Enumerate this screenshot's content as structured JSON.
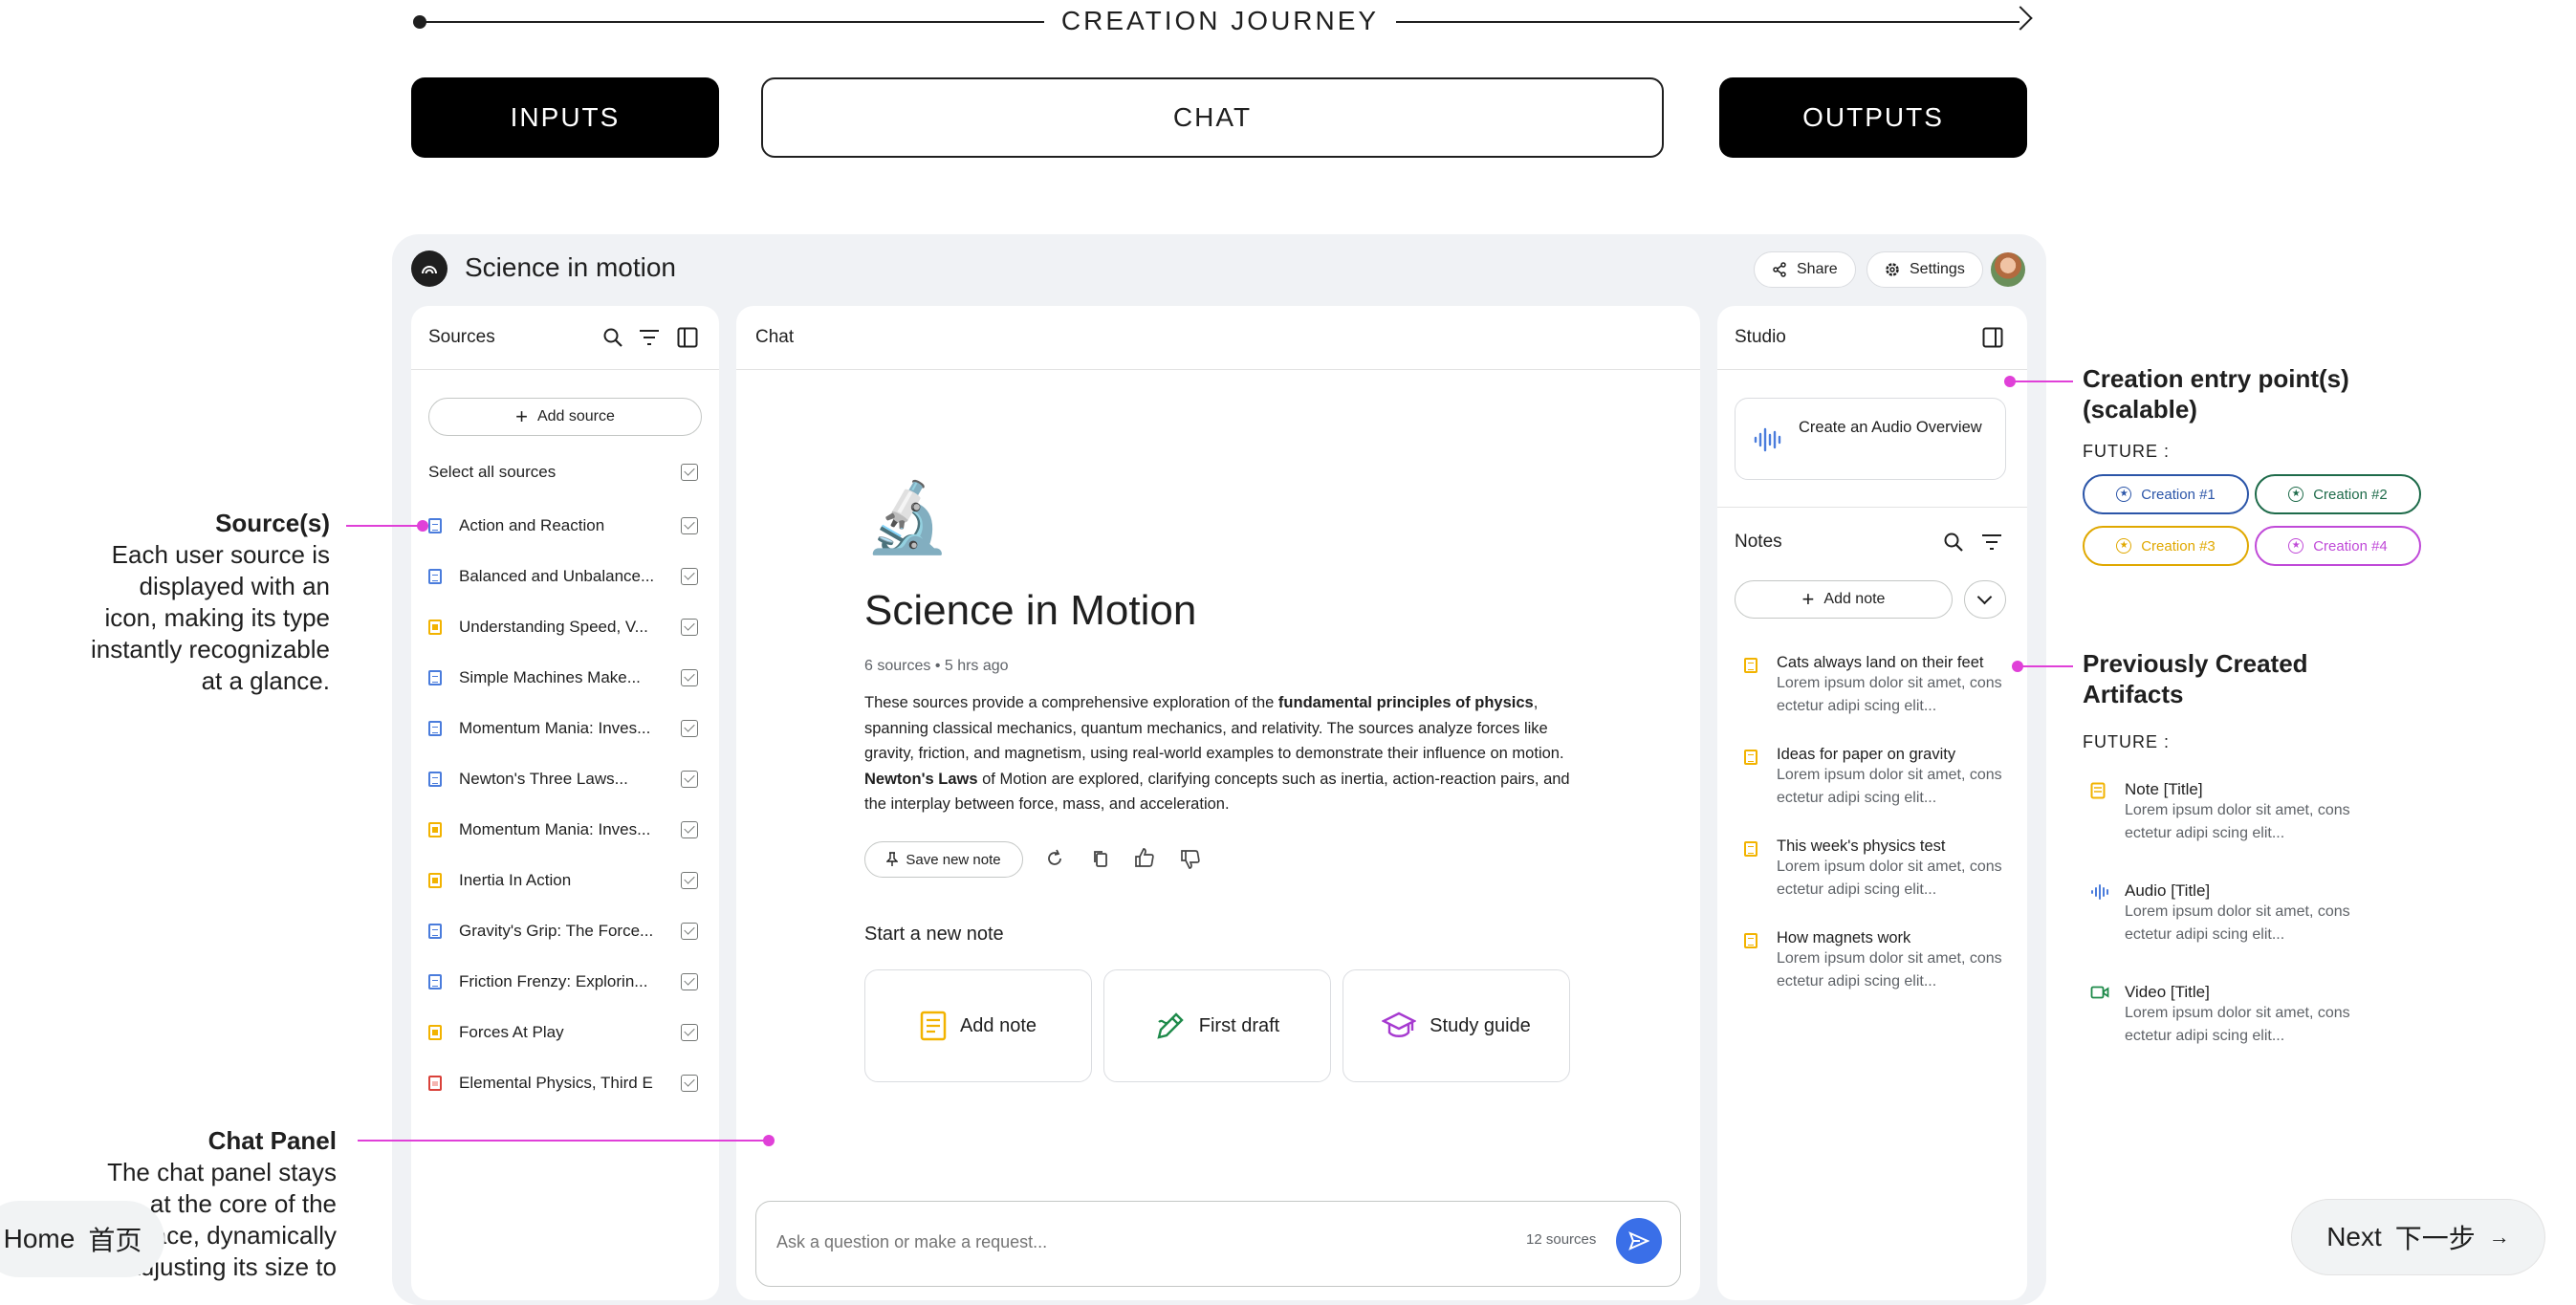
{
  "journey": {
    "title": "CREATION JOURNEY",
    "stages": [
      "INPUTS",
      "CHAT",
      "OUTPUTS"
    ]
  },
  "app": {
    "title": "Science in motion",
    "share_label": "Share",
    "settings_label": "Settings"
  },
  "sources_panel": {
    "title": "Sources",
    "add_source_label": "Add source",
    "select_all_label": "Select all sources",
    "items": [
      {
        "label": "Action and Reaction",
        "type": "doc"
      },
      {
        "label": "Balanced and Unbalance...",
        "type": "doc"
      },
      {
        "label": "Understanding Speed, V...",
        "type": "slide"
      },
      {
        "label": "Simple Machines Make...",
        "type": "doc"
      },
      {
        "label": "Momentum Mania: Inves...",
        "type": "doc"
      },
      {
        "label": "Newton's Three Laws...",
        "type": "doc"
      },
      {
        "label": "Momentum Mania: Inves...",
        "type": "slide"
      },
      {
        "label": "Inertia In Action",
        "type": "slide"
      },
      {
        "label": "Gravity's Grip: The Force...",
        "type": "doc"
      },
      {
        "label": "Friction Frenzy: Explorin...",
        "type": "doc"
      },
      {
        "label": "Forces At Play",
        "type": "slide"
      },
      {
        "label": "Elemental Physics, Third E",
        "type": "pdf"
      }
    ]
  },
  "chat_panel": {
    "title": "Chat",
    "emoji": "🔬",
    "heading": "Science in Motion",
    "meta": "6 sources • 5 hrs ago",
    "summary_parts": [
      "These sources provide a comprehensive exploration of the ",
      "fundamental principles of physics",
      ", spanning classical mechanics, quantum mechanics, and relativity. The sources analyze forces like gravity, friction, and magnetism, using real-world examples to demonstrate their influence on motion. ",
      "Newton's Laws",
      " of Motion are explored, clarifying concepts such as inertia, action-reaction pairs, and the interplay between force, mass, and acceleration."
    ],
    "save_note_label": "Save new note",
    "start_note_label": "Start a new note",
    "cards": [
      "Add note",
      "First draft",
      "Study guide"
    ],
    "input_placeholder": "Ask a question or make a request...",
    "source_count": "12 sources"
  },
  "studio_panel": {
    "title": "Studio",
    "audio_overview_label": "Create an Audio Overview",
    "notes_title": "Notes",
    "add_note_label": "Add note",
    "notes": [
      {
        "title": "Cats always land on their feet",
        "desc": "Lorem ipsum dolor sit amet, cons ectetur adipi scing elit..."
      },
      {
        "title": "Ideas for paper on gravity",
        "desc": "Lorem ipsum dolor sit amet, cons ectetur adipi scing elit..."
      },
      {
        "title": "This week's physics test",
        "desc": "Lorem ipsum dolor sit amet, cons ectetur adipi scing elit..."
      },
      {
        "title": "How magnets work",
        "desc": "Lorem ipsum dolor sit amet, cons ectetur adipi scing elit..."
      }
    ]
  },
  "annotations": {
    "sources": {
      "title": "Source(s)",
      "lines": [
        "Each user source is",
        "displayed with an",
        "icon, making its type",
        "instantly recognizable",
        "at a glance."
      ]
    },
    "chat": {
      "title": "Chat Panel",
      "lines": [
        "The chat panel stays",
        "at the core of the",
        "interface, dynamically",
        "adjusting its size to"
      ]
    },
    "creation": {
      "title_lines": [
        "Creation entry point(s)",
        "(scalable)"
      ],
      "future_label": "FUTURE :",
      "pills": [
        {
          "label": "Creation #1",
          "color": "#2b55a8"
        },
        {
          "label": "Creation #2",
          "color": "#1e6b4a"
        },
        {
          "label": "Creation #3",
          "color": "#e0a800"
        },
        {
          "label": "Creation #4",
          "color": "#c04ad8"
        }
      ]
    },
    "artifacts": {
      "title_lines": [
        "Previously Created",
        "Artifacts"
      ],
      "future_label": "FUTURE :",
      "items": [
        {
          "title": "Note [Title]",
          "desc": "Lorem ipsum dolor sit amet, cons ectetur adipi scing elit...",
          "icon": "note-icon"
        },
        {
          "title": "Audio [Title]",
          "desc": "Lorem ipsum dolor sit amet, cons ectetur adipi scing elit...",
          "icon": "audio-wave-icon"
        },
        {
          "title": "Video [Title]",
          "desc": "Lorem ipsum dolor sit amet, cons ectetur adipi scing elit...",
          "icon": "video-icon"
        }
      ]
    }
  },
  "nav": {
    "home_label": "Home",
    "home_zh": "首页",
    "next_label": "Next",
    "next_zh": "下一步",
    "next_arrow": "→"
  },
  "colors": {
    "accent_pink": "#e040d8",
    "doc_blue": "#4a7cdc",
    "slide_yellow": "#f2b300",
    "pdf_red": "#d9413a",
    "send_blue": "#3a6fe8"
  }
}
